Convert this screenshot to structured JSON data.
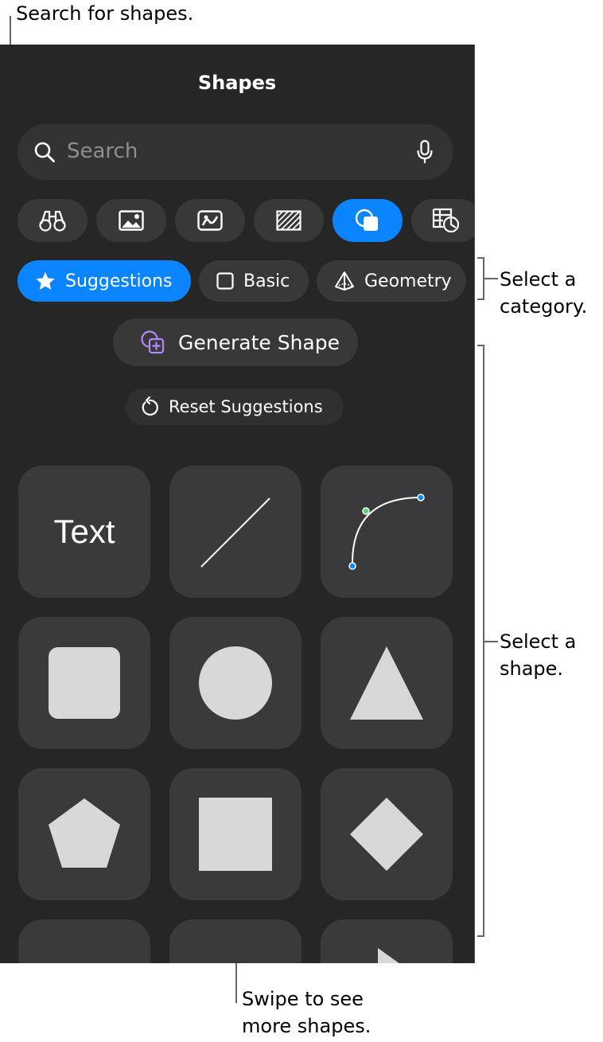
{
  "callouts": {
    "search": "Search for shapes.",
    "category": "Select a\ncategory.",
    "shape": "Select a\nshape.",
    "swipe": "Swipe to see\nmore shapes."
  },
  "panel": {
    "title": "Shapes",
    "search_placeholder": "Search"
  },
  "type_tabs": [
    {
      "icon": "binoculars-icon"
    },
    {
      "icon": "photo-icon"
    },
    {
      "icon": "image-gallery-icon"
    },
    {
      "icon": "pattern-icon"
    },
    {
      "icon": "shapes-icon",
      "active": true
    },
    {
      "icon": "table-chart-icon"
    }
  ],
  "categories": [
    {
      "label": "Suggestions",
      "icon": "star-icon",
      "active": true
    },
    {
      "label": "Basic",
      "icon": "square-outline-icon"
    },
    {
      "label": "Geometry",
      "icon": "pyramid-icon"
    }
  ],
  "actions": {
    "generate_label": "Generate Shape",
    "reset_label": "Reset Suggestions"
  },
  "shapes": {
    "text_tile_label": "Text"
  },
  "colors": {
    "accent": "#0a84ff",
    "panel_bg": "#262626",
    "tile_bg": "#3a3a3c",
    "shape_fill": "#d8d8d8",
    "generate_icon": "#b388ff"
  }
}
